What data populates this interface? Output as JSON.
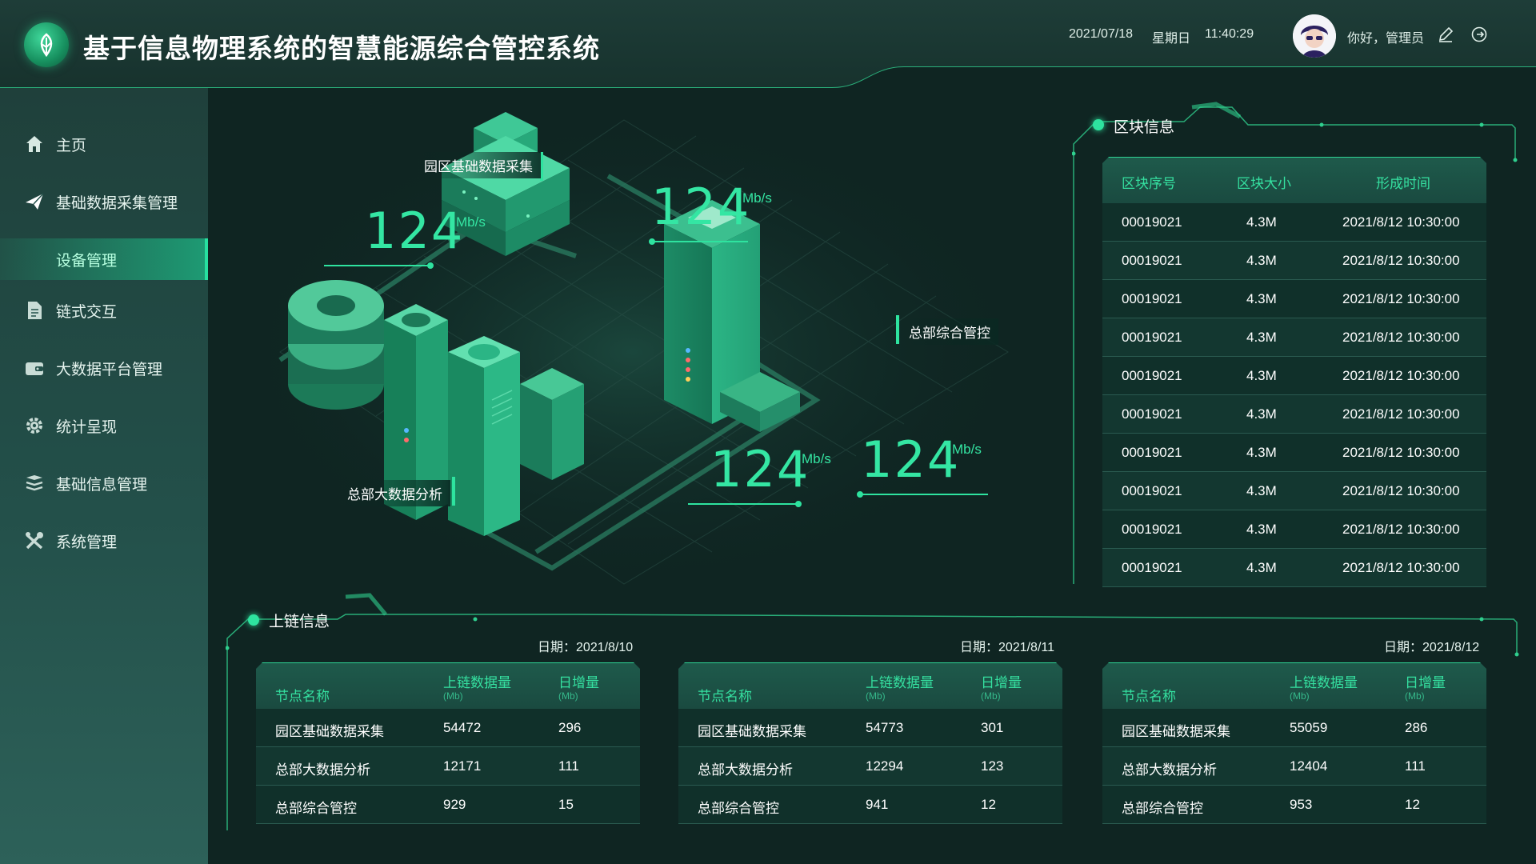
{
  "header": {
    "title": "基于信息物理系统的智慧能源综合管控系统",
    "date": "2021/07/18",
    "weekday": "星期日",
    "time": "11:40:29",
    "greeting": "你好，管理员",
    "logo_icon": "leaf-logo-icon",
    "edit_icon": "pencil-icon",
    "logout_icon": "logout-icon"
  },
  "sidebar": {
    "items": [
      {
        "label": "主页",
        "icon": "home-icon"
      },
      {
        "label": "基础数据采集管理",
        "icon": "paper-plane-icon"
      },
      {
        "label": "设备管理",
        "icon": "",
        "active": true
      },
      {
        "label": "链式交互",
        "icon": "document-icon"
      },
      {
        "label": "大数据平台管理",
        "icon": "wallet-icon"
      },
      {
        "label": "统计呈现",
        "icon": "gear-icon"
      },
      {
        "label": "基础信息管理",
        "icon": "layers-icon"
      },
      {
        "label": "系统管理",
        "icon": "tools-icon"
      }
    ]
  },
  "iso": {
    "labels": {
      "park": "园区基础数据采集",
      "hq_control": "总部综合管控",
      "hq_bigdata": "总部大数据分析"
    },
    "speeds": [
      "124",
      "124",
      "124",
      "124"
    ],
    "unit": "Mb/s"
  },
  "block_info": {
    "title": "区块信息",
    "columns": [
      "区块序号",
      "区块大小",
      "形成时间"
    ],
    "rows": [
      [
        "00019021",
        "4.3M",
        "2021/8/12 10:30:00"
      ],
      [
        "00019021",
        "4.3M",
        "2021/8/12 10:30:00"
      ],
      [
        "00019021",
        "4.3M",
        "2021/8/12 10:30:00"
      ],
      [
        "00019021",
        "4.3M",
        "2021/8/12 10:30:00"
      ],
      [
        "00019021",
        "4.3M",
        "2021/8/12 10:30:00"
      ],
      [
        "00019021",
        "4.3M",
        "2021/8/12 10:30:00"
      ],
      [
        "00019021",
        "4.3M",
        "2021/8/12 10:30:00"
      ],
      [
        "00019021",
        "4.3M",
        "2021/8/12 10:30:00"
      ],
      [
        "00019021",
        "4.3M",
        "2021/8/12 10:30:00"
      ],
      [
        "00019021",
        "4.3M",
        "2021/8/12 10:30:00"
      ]
    ]
  },
  "chain_info": {
    "title": "上链信息",
    "date_prefix": "日期：",
    "col_name": "节点名称",
    "col_amount": "上链数据量",
    "col_daily": "日增量",
    "col_unit": "(Mb)",
    "tables": [
      {
        "date": "2021/8/10",
        "rows": [
          [
            "园区基础数据采集",
            "54472",
            "296"
          ],
          [
            "总部大数据分析",
            "12171",
            "111"
          ],
          [
            "总部综合管控",
            "929",
            "15"
          ]
        ]
      },
      {
        "date": "2021/8/11",
        "rows": [
          [
            "园区基础数据采集",
            "54773",
            "301"
          ],
          [
            "总部大数据分析",
            "12294",
            "123"
          ],
          [
            "总部综合管控",
            "941",
            "12"
          ]
        ]
      },
      {
        "date": "2021/8/12",
        "rows": [
          [
            "园区基础数据采集",
            "55059",
            "286"
          ],
          [
            "总部大数据分析",
            "12404",
            "111"
          ],
          [
            "总部综合管控",
            "953",
            "12"
          ]
        ]
      }
    ]
  },
  "colors": {
    "accent": "#2ee39f",
    "background": "#0f2522",
    "sidebar": "#23504a",
    "active_nav": "#1e9a73"
  }
}
